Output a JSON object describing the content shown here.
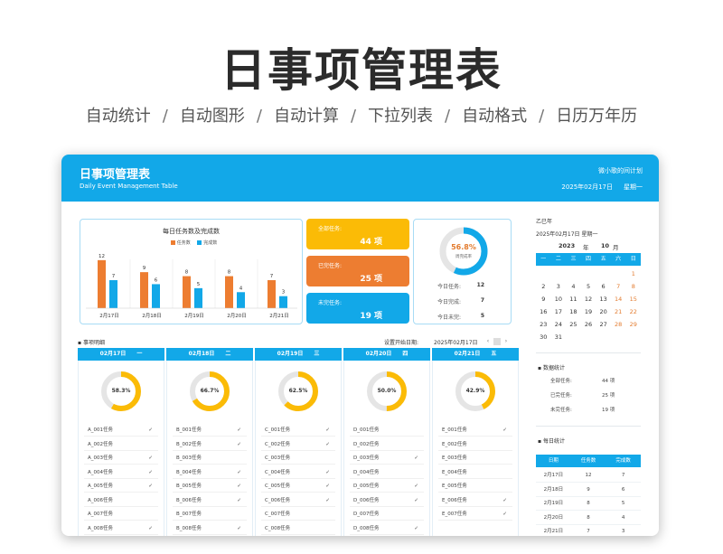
{
  "hero": {
    "title": "日事项管理表",
    "features": [
      "自动统计",
      "自动图形",
      "自动计算",
      "下拉列表",
      "自动格式",
      "日历万年历"
    ],
    "separator": "/"
  },
  "header": {
    "title": "日事项管理表",
    "subtitle": "Daily Event Management Table",
    "wechat": "微小歌的间计划",
    "date": "2025年02月17日",
    "weekday": "星期一"
  },
  "chart": {
    "title": "每日任务数及完成数",
    "legend": [
      "任务数",
      "完成数"
    ]
  },
  "chart_data": {
    "type": "bar",
    "title": "每日任务数及完成数",
    "categories": [
      "2月17日",
      "2月18日",
      "2月19日",
      "2月20日",
      "2月21日"
    ],
    "series": [
      {
        "name": "任务数",
        "values": [
          12,
          9,
          8,
          8,
          7
        ]
      },
      {
        "name": "完成数",
        "values": [
          7,
          6,
          5,
          4,
          3
        ]
      }
    ],
    "ylim": [
      0,
      14
    ],
    "colors": [
      "#ed7d31",
      "#12a8e8"
    ],
    "grid": false,
    "legend_position": "top"
  },
  "stats": {
    "all_label": "全部任务:",
    "all_value": "44 项",
    "done_label": "已完任务:",
    "done_value": "25 项",
    "undone_label": "未完任务:",
    "undone_value": "19 项",
    "colors": {
      "all": "#fbbb06",
      "done": "#ed7d31",
      "undone": "#12a8e8"
    }
  },
  "completion": {
    "percent": "56.8%",
    "percent_value": 56.8,
    "label": "周完成率",
    "today_tasks_label": "今日任务:",
    "today_tasks": "12",
    "today_done_label": "今日完成:",
    "today_done": "7",
    "today_undone_label": "今日未完:",
    "today_undone": "5"
  },
  "tasks_section": {
    "title": "事项明细",
    "start_label": "设置开始日期:",
    "start_value": "2025年02月17日"
  },
  "days": [
    {
      "date": "02月17日",
      "weekday": "一",
      "percent": "58.3%",
      "percent_value": 58.3,
      "tasks": [
        {
          "name": "A_001任务",
          "mark": "✓"
        },
        {
          "name": "A_002任务",
          "mark": ""
        },
        {
          "name": "A_003任务",
          "mark": "✓"
        },
        {
          "name": "A_004任务",
          "mark": "✓"
        },
        {
          "name": "A_005任务",
          "mark": "✓"
        },
        {
          "name": "A_006任务",
          "mark": ""
        },
        {
          "name": "A_007任务",
          "mark": ""
        },
        {
          "name": "A_008任务",
          "mark": "✓"
        }
      ]
    },
    {
      "date": "02月18日",
      "weekday": "二",
      "percent": "66.7%",
      "percent_value": 66.7,
      "tasks": [
        {
          "name": "B_001任务",
          "mark": "✓"
        },
        {
          "name": "B_002任务",
          "mark": "✓"
        },
        {
          "name": "B_003任务",
          "mark": ""
        },
        {
          "name": "B_004任务",
          "mark": "✓"
        },
        {
          "name": "B_005任务",
          "mark": "✓"
        },
        {
          "name": "B_006任务",
          "mark": "✓"
        },
        {
          "name": "B_007任务",
          "mark": ""
        },
        {
          "name": "B_008任务",
          "mark": "✓"
        }
      ]
    },
    {
      "date": "02月19日",
      "weekday": "三",
      "percent": "62.5%",
      "percent_value": 62.5,
      "tasks": [
        {
          "name": "C_001任务",
          "mark": "✓"
        },
        {
          "name": "C_002任务",
          "mark": "✓"
        },
        {
          "name": "C_003任务",
          "mark": ""
        },
        {
          "name": "C_004任务",
          "mark": "✓"
        },
        {
          "name": "C_005任务",
          "mark": "✓"
        },
        {
          "name": "C_006任务",
          "mark": "✓"
        },
        {
          "name": "C_007任务",
          "mark": ""
        },
        {
          "name": "C_008任务",
          "mark": ""
        }
      ]
    },
    {
      "date": "02月20日",
      "weekday": "四",
      "percent": "50.0%",
      "percent_value": 50.0,
      "tasks": [
        {
          "name": "D_001任务",
          "mark": ""
        },
        {
          "name": "D_002任务",
          "mark": ""
        },
        {
          "name": "D_003任务",
          "mark": "✓"
        },
        {
          "name": "D_004任务",
          "mark": ""
        },
        {
          "name": "D_005任务",
          "mark": "✓"
        },
        {
          "name": "D_006任务",
          "mark": "✓"
        },
        {
          "name": "D_007任务",
          "mark": ""
        },
        {
          "name": "D_008任务",
          "mark": "✓"
        }
      ]
    },
    {
      "date": "02月21日",
      "weekday": "五",
      "percent": "42.9%",
      "percent_value": 42.9,
      "tasks": [
        {
          "name": "E_001任务",
          "mark": "✓"
        },
        {
          "name": "E_002任务",
          "mark": ""
        },
        {
          "name": "E_003任务",
          "mark": ""
        },
        {
          "name": "E_004任务",
          "mark": ""
        },
        {
          "name": "E_005任务",
          "mark": ""
        },
        {
          "name": "E_006任务",
          "mark": "✓"
        },
        {
          "name": "E_007任务",
          "mark": "✓"
        }
      ]
    }
  ],
  "sidebar": {
    "lunar_year": "乙巳年",
    "date_line": "2025年02月17日   星期一",
    "year": "2023",
    "year_unit": "年",
    "month": "10",
    "month_unit": "月",
    "weekdays": [
      "一",
      "二",
      "三",
      "四",
      "五",
      "六",
      "日"
    ],
    "weeks": [
      [
        "",
        "",
        "",
        "",
        "",
        "",
        "1"
      ],
      [
        "2",
        "3",
        "4",
        "5",
        "6",
        "7",
        "8"
      ],
      [
        "9",
        "10",
        "11",
        "12",
        "13",
        "14",
        "15"
      ],
      [
        "16",
        "17",
        "18",
        "19",
        "20",
        "21",
        "22"
      ],
      [
        "23",
        "24",
        "25",
        "26",
        "27",
        "28",
        "29"
      ],
      [
        "30",
        "31",
        "",
        "",
        "",
        "",
        ""
      ]
    ],
    "data_stats_title": "数据统计",
    "data_stats": [
      {
        "k": "全部任务:",
        "v": "44 项"
      },
      {
        "k": "已完任务:",
        "v": "25 项"
      },
      {
        "k": "未完任务:",
        "v": "19 项"
      }
    ],
    "daily_title": "每日统计",
    "daily_headers": [
      "日期",
      "任务数",
      "完成数"
    ],
    "daily_rows": [
      [
        "2月17日",
        "12",
        "7"
      ],
      [
        "2月18日",
        "9",
        "6"
      ],
      [
        "2月19日",
        "8",
        "5"
      ],
      [
        "2月20日",
        "8",
        "4"
      ],
      [
        "2月21日",
        "7",
        "3"
      ]
    ]
  },
  "colors": {
    "accent": "#12a8e8",
    "orange": "#ed7d31",
    "yellow": "#fbbb06",
    "weekend": "#e37b2e"
  }
}
